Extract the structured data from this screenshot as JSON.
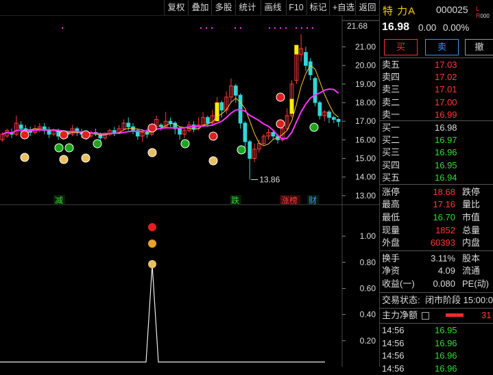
{
  "toolbar": {
    "buttons": [
      "复权",
      "叠加",
      "多股",
      "统计",
      "画线",
      "F10",
      "标记",
      "+自选",
      "返回"
    ]
  },
  "stock": {
    "name": "特 力A",
    "code": "000025",
    "flags": "L R",
    "flag_extra": "000",
    "price": "16.98",
    "change": "0.00",
    "change_pct": "0.00%"
  },
  "trade_buttons": {
    "buy": "买",
    "sell": "卖",
    "cancel": "撤"
  },
  "order_book": {
    "asks": [
      {
        "label": "卖五",
        "price": "17.03"
      },
      {
        "label": "卖四",
        "price": "17.02"
      },
      {
        "label": "卖三",
        "price": "17.01"
      },
      {
        "label": "卖二",
        "price": "17.00"
      },
      {
        "label": "卖一",
        "price": "16.99"
      }
    ],
    "bids": [
      {
        "label": "买一",
        "price": "16.98"
      },
      {
        "label": "买二",
        "price": "16.97"
      },
      {
        "label": "买三",
        "price": "16.96"
      },
      {
        "label": "买四",
        "price": "16.95"
      },
      {
        "label": "买五",
        "price": "16.94"
      }
    ]
  },
  "quote": {
    "limit_up_label": "涨停",
    "limit_up": "18.68",
    "limit_down_label": "跌停",
    "high_label": "最高",
    "high": "17.16",
    "vol_ratio_label": "量比",
    "low_label": "最低",
    "low": "16.70",
    "mkt_cap_label": "市值",
    "now_label": "现量",
    "now": "1852",
    "total_vol_label": "总量",
    "outer_label": "外盘",
    "outer": "60393",
    "inner_label": "内盘",
    "turnover_label": "换手",
    "turnover": "3.11%",
    "equity_label": "股本",
    "nav_label": "净资",
    "nav": "4.09",
    "circ_label": "流通",
    "eps_label": "收益(一)",
    "eps": "0.080",
    "pe_label": "PE(动)"
  },
  "status": {
    "label": "交易状态:",
    "value": "闭市阶段 15:00:0"
  },
  "main_flow": {
    "label": "主力净额",
    "value": "31",
    "bar_color": "#ff2a2a"
  },
  "ticks": [
    {
      "time": "14:56",
      "price": "16.95"
    },
    {
      "time": "14:56",
      "price": "16.96"
    },
    {
      "time": "14:56",
      "price": "16.96"
    },
    {
      "time": "14:56",
      "price": "16.96"
    }
  ],
  "chart_labels": {
    "max_price": "21.68",
    "min_callout": "13.86",
    "events": [
      "减",
      "跌",
      "涨榜",
      "财"
    ]
  },
  "chart_data": {
    "type": "candlestick",
    "price_axis": {
      "ticks": [
        "21.00",
        "20.00",
        "19.00",
        "18.00",
        "17.00",
        "16.00",
        "15.00",
        "14.00",
        "13.00"
      ],
      "min": 12.7,
      "max": 21.9
    },
    "candles": [
      [
        16.0,
        16.3,
        15.9,
        16.4
      ],
      [
        16.2,
        16.5,
        16.1,
        16.6
      ],
      [
        16.4,
        16.3,
        16.1,
        16.6
      ],
      [
        16.3,
        16.9,
        16.2,
        17.3
      ],
      [
        16.8,
        16.6,
        16.4,
        17.0
      ],
      [
        16.6,
        16.5,
        16.3,
        16.8
      ],
      [
        16.5,
        16.4,
        16.2,
        16.7
      ],
      [
        16.4,
        16.6,
        16.3,
        16.8
      ],
      [
        16.6,
        16.7,
        16.4,
        16.9
      ],
      [
        16.7,
        16.5,
        16.3,
        16.9
      ],
      [
        16.5,
        16.3,
        16.1,
        16.7
      ],
      [
        16.3,
        16.5,
        16.2,
        16.6
      ],
      [
        16.5,
        16.2,
        16.0,
        16.6
      ],
      [
        16.2,
        16.4,
        16.0,
        16.5
      ],
      [
        16.4,
        16.3,
        16.1,
        16.5
      ],
      [
        16.3,
        16.6,
        16.2,
        16.8
      ],
      [
        16.6,
        16.4,
        16.2,
        16.7
      ],
      [
        16.4,
        16.3,
        16.1,
        16.6
      ],
      [
        16.3,
        16.2,
        16.0,
        16.5
      ],
      [
        16.2,
        16.4,
        16.1,
        16.5
      ],
      [
        16.4,
        16.3,
        16.2,
        16.6
      ],
      [
        16.3,
        16.1,
        15.9,
        16.4
      ],
      [
        16.1,
        16.3,
        16.0,
        16.4
      ],
      [
        16.3,
        16.5,
        16.2,
        16.6
      ],
      [
        16.5,
        16.4,
        16.2,
        16.7
      ],
      [
        16.4,
        16.6,
        16.3,
        16.8
      ],
      [
        16.6,
        16.9,
        16.5,
        17.1
      ],
      [
        16.9,
        16.7,
        16.5,
        17.2
      ],
      [
        16.7,
        16.5,
        16.3,
        16.9
      ],
      [
        16.5,
        16.2,
        16.0,
        16.6
      ],
      [
        16.2,
        16.4,
        15.9,
        16.5
      ],
      [
        16.4,
        16.3,
        16.1,
        16.6
      ],
      [
        16.3,
        16.7,
        16.2,
        16.8
      ],
      [
        16.7,
        17.1,
        16.6,
        17.3
      ],
      [
        16.8,
        16.7,
        16.5,
        16.9
      ],
      [
        16.7,
        17.0,
        16.6,
        17.5
      ],
      [
        17.0,
        16.9,
        16.7,
        17.2
      ],
      [
        16.9,
        16.6,
        16.3,
        17.0
      ],
      [
        16.6,
        16.3,
        16.0,
        16.7
      ],
      [
        16.3,
        16.5,
        16.1,
        16.7
      ],
      [
        16.5,
        16.8,
        16.4,
        17.0
      ],
      [
        16.8,
        16.6,
        16.4,
        17.0
      ],
      [
        16.6,
        16.8,
        16.5,
        17.2
      ],
      [
        16.8,
        17.2,
        16.7,
        17.5
      ],
      [
        17.2,
        16.9,
        16.7,
        17.3
      ],
      [
        16.9,
        17.3,
        16.8,
        17.6
      ],
      [
        17.3,
        18.0,
        17.1,
        18.3
      ],
      [
        18.0,
        17.6,
        17.2,
        18.1
      ],
      [
        17.6,
        18.3,
        17.4,
        18.6
      ],
      [
        18.3,
        18.9,
        18.0,
        19.3
      ],
      [
        18.9,
        18.4,
        18.0,
        19.0
      ],
      [
        18.4,
        16.9,
        16.6,
        18.5
      ],
      [
        16.9,
        15.9,
        15.3,
        17.0
      ],
      [
        15.9,
        15.0,
        13.86,
        16.0
      ],
      [
        15.0,
        15.5,
        14.8,
        15.8
      ],
      [
        15.5,
        15.8,
        15.3,
        16.0
      ],
      [
        15.8,
        16.2,
        15.7,
        16.3
      ],
      [
        16.2,
        16.4,
        16.0,
        16.6
      ],
      [
        16.4,
        16.2,
        16.0,
        16.5
      ],
      [
        16.2,
        16.0,
        15.8,
        16.3
      ],
      [
        16.0,
        16.6,
        15.9,
        16.7
      ],
      [
        16.6,
        17.3,
        16.5,
        17.7
      ],
      [
        17.3,
        19.0,
        17.2,
        19.2
      ],
      [
        19.2,
        20.6,
        19.0,
        21.1
      ],
      [
        20.6,
        20.9,
        20.2,
        21.68
      ],
      [
        20.7,
        20.0,
        19.7,
        21.0
      ],
      [
        20.2,
        19.5,
        19.2,
        20.4
      ],
      [
        19.3,
        18.0,
        17.8,
        19.4
      ],
      [
        18.0,
        17.3,
        17.1,
        18.1
      ],
      [
        17.3,
        17.5,
        17.0,
        17.6
      ],
      [
        17.5,
        17.2,
        16.9,
        17.6
      ],
      [
        17.2,
        17.1,
        16.9,
        17.3
      ],
      [
        17.1,
        16.98,
        16.7,
        17.16
      ]
    ],
    "bottom_axis": {
      "ticks": [
        "1.00",
        "0.80",
        "0.60",
        "0.40",
        "0.20"
      ],
      "min": 0,
      "max": 1.2
    }
  },
  "colors": {
    "up": "#ff3b3b",
    "down": "#33d6d6",
    "ma_magenta": "#ff33ff",
    "ma_yellow": "#ffcc33",
    "limit_up_bar": "#ffee00"
  }
}
